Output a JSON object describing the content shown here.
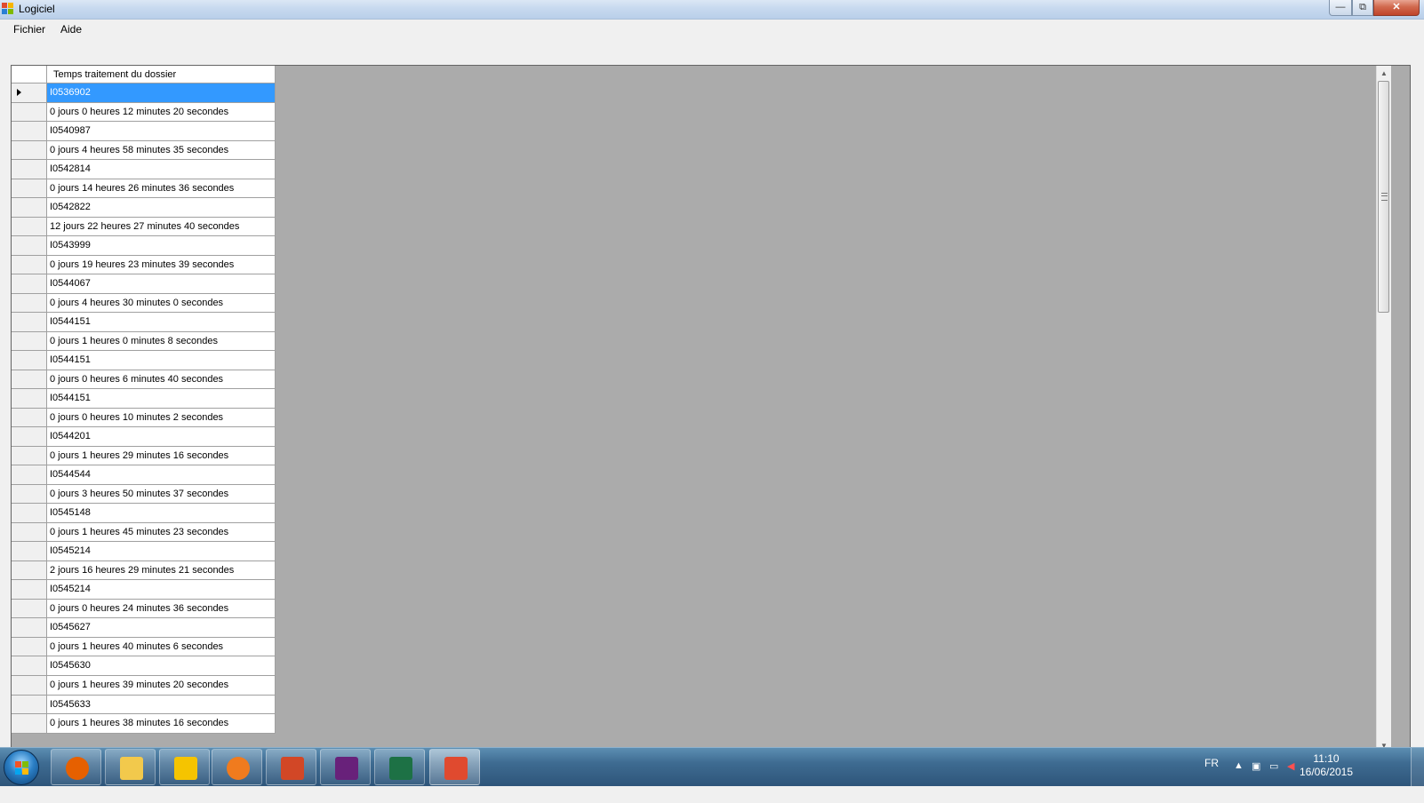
{
  "window": {
    "title": "Logiciel",
    "minimize_glyph": "—",
    "maximize_glyph": "⧉",
    "close_glyph": "✕"
  },
  "menu": {
    "items": [
      {
        "label": "Fichier"
      },
      {
        "label": "Aide"
      }
    ]
  },
  "grid": {
    "column_header": "Temps traitement du dossier",
    "selected_row_index": 0,
    "rows": [
      "I0536902",
      "0 jours 0 heures 12 minutes 20 secondes",
      "I0540987",
      "0 jours 4 heures 58 minutes 35 secondes",
      "I0542814",
      "0 jours 14 heures 26 minutes 36 secondes",
      "I0542822",
      "12 jours 22 heures 27 minutes 40 secondes",
      "I0543999",
      "0 jours 19 heures 23 minutes 39 secondes",
      "I0544067",
      "0 jours 4 heures 30 minutes 0 secondes",
      "I0544151",
      "0 jours 1 heures 0 minutes 8 secondes",
      "I0544151",
      "0 jours 0 heures 6 minutes 40 secondes",
      "I0544151",
      "0 jours 0 heures 10 minutes 2 secondes",
      "I0544201",
      "0 jours 1 heures 29 minutes 16 secondes",
      "I0544544",
      "0 jours 3 heures 50 minutes 37 secondes",
      "I0545148",
      "0 jours 1 heures 45 minutes 23 secondes",
      "I0545214",
      "2 jours 16 heures 29 minutes 21 secondes",
      "I0545214",
      "0 jours 0 heures 24 minutes 36 secondes",
      "I0545627",
      "0 jours 1 heures 40 minutes 6 secondes",
      "I0545630",
      "0 jours 1 heures 39 minutes 20 secondes",
      "I0545633",
      "0 jours 1 heures 38 minutes 16 secondes"
    ]
  },
  "scrollbar": {
    "up_glyph": "▲",
    "down_glyph": "▼"
  },
  "taskbar": {
    "apps": [
      {
        "name": "firefox-icon",
        "color": "#e66000"
      },
      {
        "name": "file-explorer-icon",
        "color": "#f2c94c"
      },
      {
        "name": "app-b-icon",
        "color": "#f5c400"
      },
      {
        "name": "media-player-icon",
        "color": "#f07b1e"
      },
      {
        "name": "presentation-app-icon",
        "color": "#d24726"
      },
      {
        "name": "visual-studio-icon",
        "color": "#68217a"
      },
      {
        "name": "excel-icon",
        "color": "#1d7145"
      },
      {
        "name": "logiciel-app-icon",
        "color": "#e04a2f",
        "active": true
      }
    ],
    "language": "FR",
    "time": "11:10",
    "date": "16/06/2015"
  },
  "colors": {
    "selection": "#3399ff",
    "grid_background": "#ababab"
  }
}
